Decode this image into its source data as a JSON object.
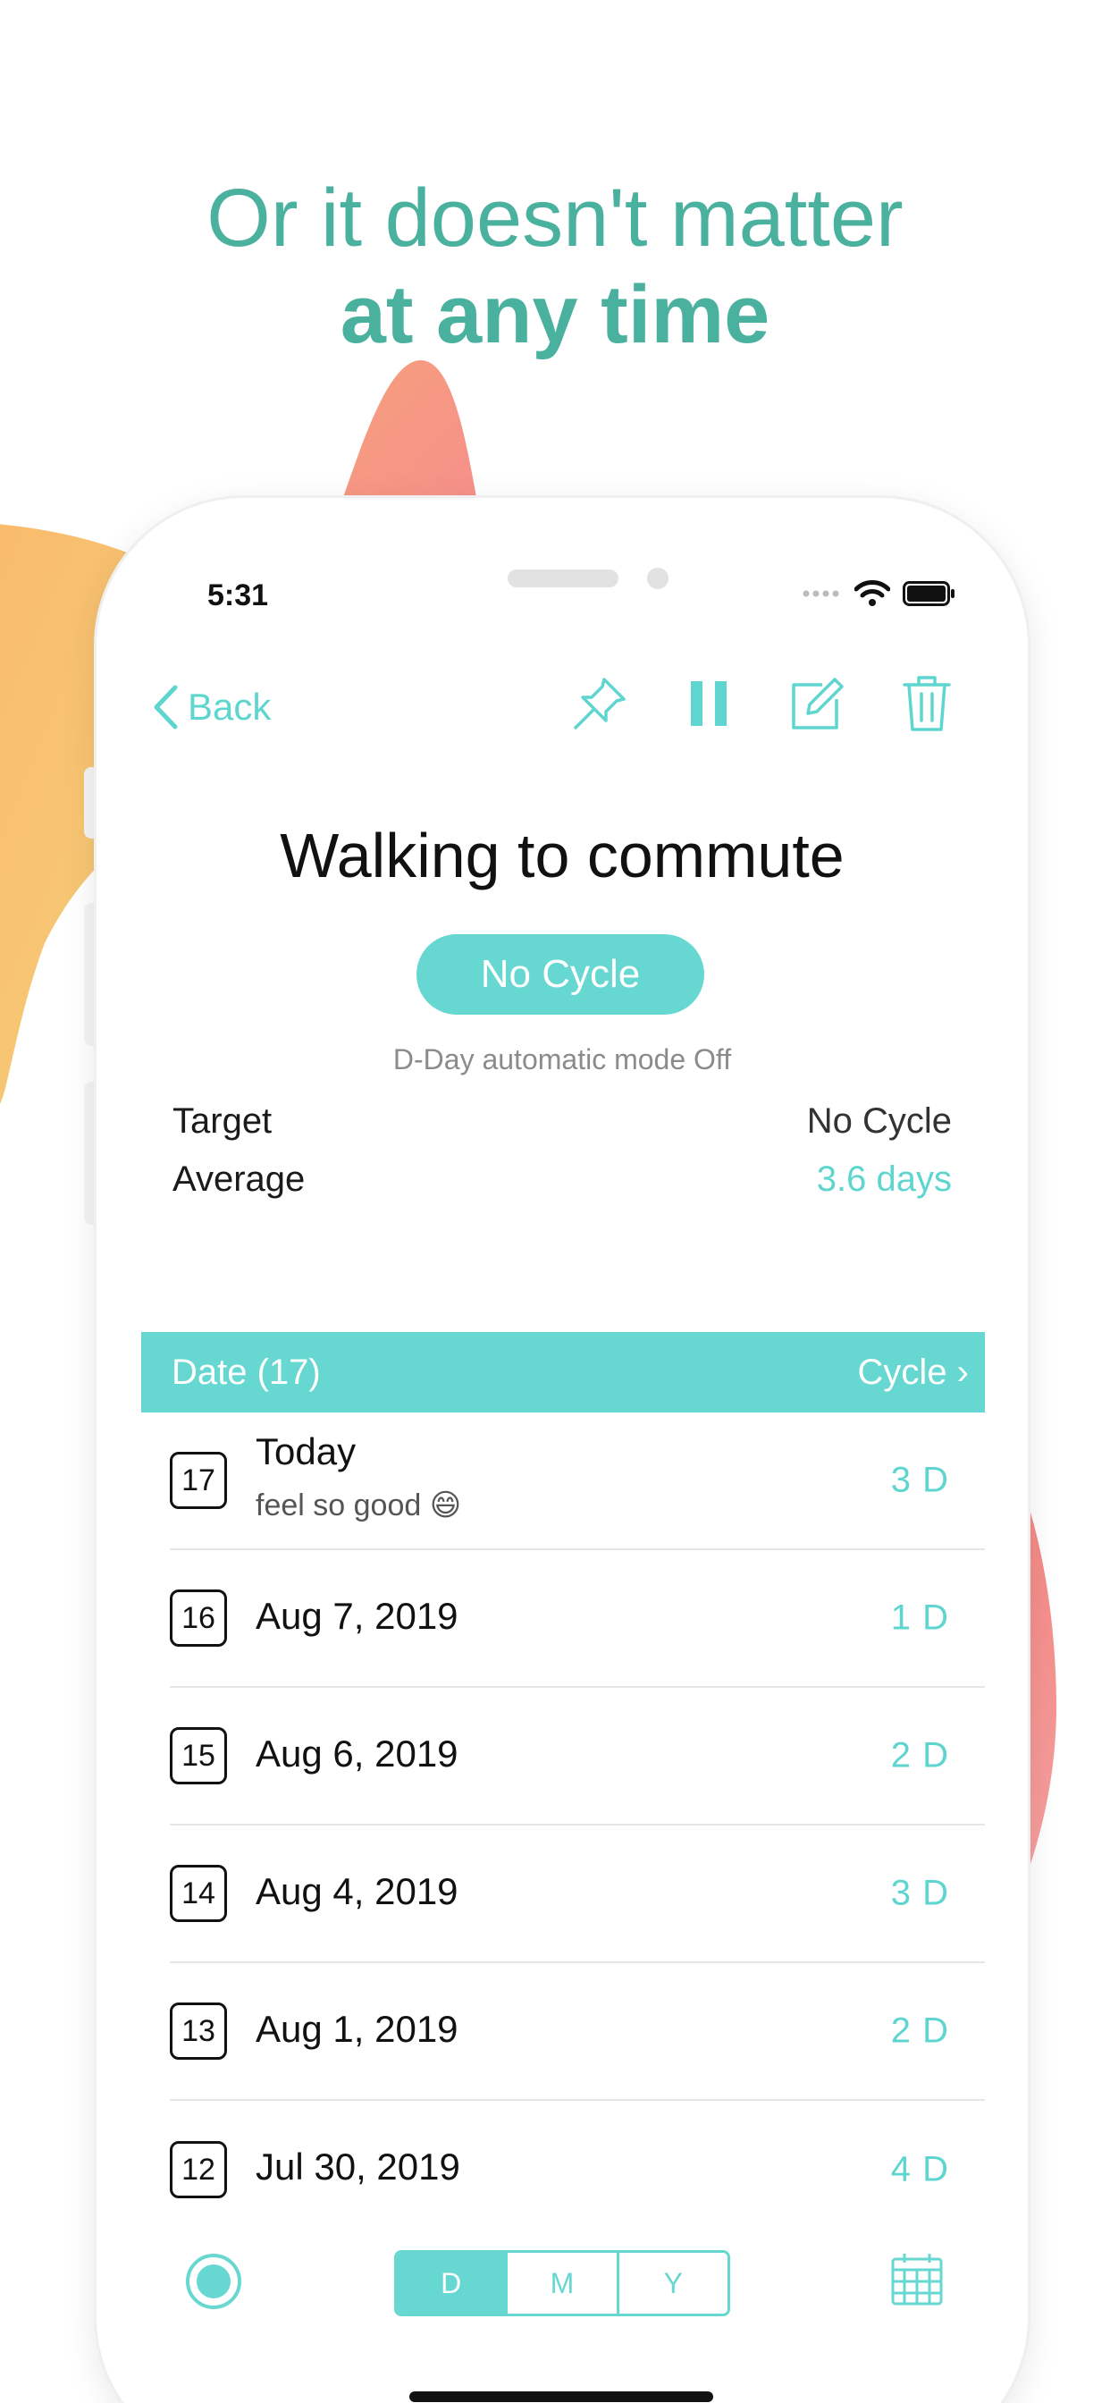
{
  "headline": {
    "line1": "Or it doesn't matter",
    "line2": "at any time"
  },
  "status_bar": {
    "time": "5:31"
  },
  "nav": {
    "back_label": "Back"
  },
  "detail": {
    "title": "Walking to commute",
    "cycle_pill": "No Cycle",
    "mode_note": "D-Day automatic mode Off",
    "stats": [
      {
        "label": "Target",
        "value": "No Cycle"
      },
      {
        "label": "Average",
        "value": "3.6 days"
      }
    ]
  },
  "table": {
    "date_header": "Date (17)",
    "cycle_header": "Cycle ›",
    "rows": [
      {
        "num": "17",
        "date": "Today",
        "note": "feel so good 😄",
        "cycle": "3 D"
      },
      {
        "num": "16",
        "date": "Aug 7, 2019",
        "cycle": "1 D"
      },
      {
        "num": "15",
        "date": "Aug 6, 2019",
        "cycle": "2 D"
      },
      {
        "num": "14",
        "date": "Aug 4, 2019",
        "cycle": "3 D"
      },
      {
        "num": "13",
        "date": "Aug 1, 2019",
        "cycle": "2 D"
      },
      {
        "num": "12",
        "date": "Jul 30, 2019",
        "cycle": "4 D"
      }
    ]
  },
  "bottom_bar": {
    "segments": [
      "D",
      "M",
      "Y"
    ],
    "active": "D"
  },
  "colors": {
    "accent": "#66d7d1",
    "headline": "#4bb19f",
    "orange": "#f6bf69",
    "coral": "#f59a8e",
    "pink": "#f4817f"
  },
  "icons": [
    "chevron-left-icon",
    "pin-icon",
    "pause-icon",
    "edit-icon",
    "trash-icon",
    "record-icon",
    "calendar-icon"
  ]
}
